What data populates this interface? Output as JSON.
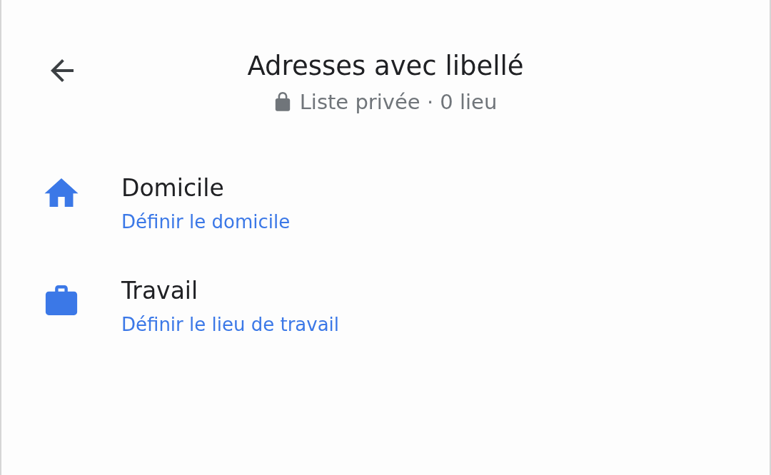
{
  "header": {
    "title": "Adresses avec libellé",
    "subtitle": "Liste privée · 0 lieu"
  },
  "places": [
    {
      "kind": "home",
      "name": "Domicile",
      "action": "Définir le domicile"
    },
    {
      "kind": "work",
      "name": "Travail",
      "action": "Définir le lieu de travail"
    }
  ]
}
